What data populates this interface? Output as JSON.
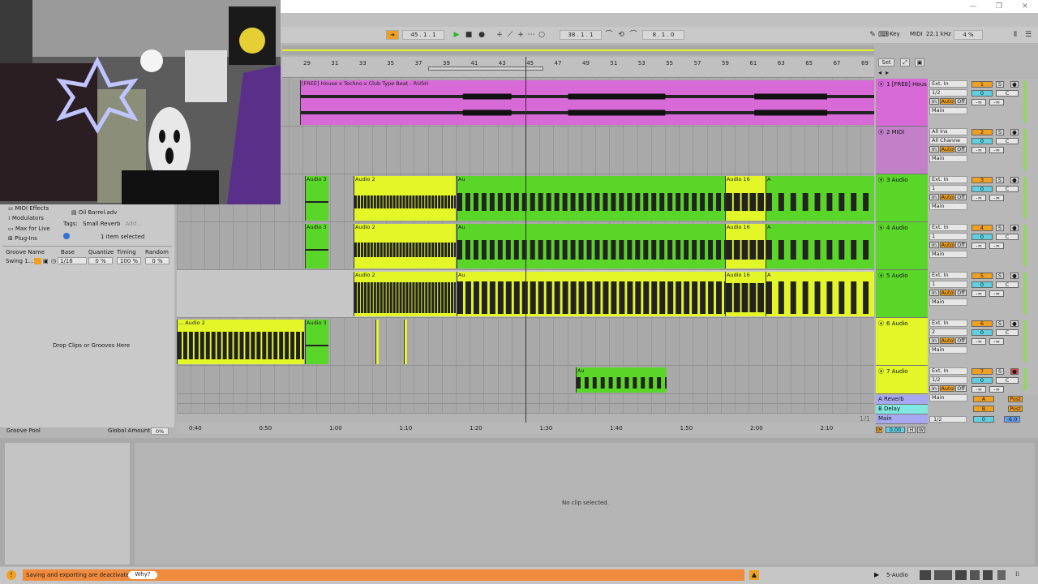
{
  "window": {
    "minimize": "—",
    "restore": "❐",
    "close": "✕"
  },
  "transport": {
    "position": "45 . 1 . 1",
    "loop_start": "38 . 1 . 1",
    "loop_length": "8 . 1 . 0",
    "key_label": "Key",
    "midi_label": "MIDI",
    "sample_rate": "22.1 kHz",
    "cpu": "4 %"
  },
  "ruler": {
    "bars": [
      "29",
      "31",
      "33",
      "35",
      "37",
      "39",
      "41",
      "43",
      "45",
      "47",
      "49",
      "51",
      "53",
      "55",
      "57",
      "59",
      "61",
      "63",
      "65",
      "67",
      "69"
    ],
    "set_label": "Set"
  },
  "timeline": {
    "times": [
      "0:40",
      "0:50",
      "1:00",
      "1:10",
      "1:20",
      "1:30",
      "1:40",
      "1:50",
      "2:00",
      "2:10"
    ],
    "page": "1/1"
  },
  "clips": {
    "track1": "[FREE] House x Techno x Club Type Beat - RUSH",
    "audio3": "Audio 3",
    "audio2": "Audio 2",
    "audio16": "Audio 16",
    "a": "A",
    "au": "Au",
    "ellipsis_audio2": "... Audio 2"
  },
  "tracks": [
    {
      "name": "1 [FREE] Hous",
      "input": "Ext. In",
      "channel": "1/2",
      "output": "Main",
      "number": "1",
      "color": "#d86ad8"
    },
    {
      "name": "2 MIDI",
      "input": "All Ins",
      "channel": "All Channe",
      "output": "Main",
      "number": "2",
      "color": "#c280c8"
    },
    {
      "name": "3 Audio",
      "input": "Ext. In",
      "channel": "1",
      "output": "Main",
      "number": "3",
      "color": "#5ad628"
    },
    {
      "name": "4 Audio",
      "input": "Ext. In",
      "channel": "1",
      "output": "Main",
      "number": "4",
      "color": "#5ad628"
    },
    {
      "name": "5 Audio",
      "input": "Ext. In",
      "channel": "1",
      "output": "Main",
      "number": "5",
      "color": "#5ad628"
    },
    {
      "name": "6 Audio",
      "input": "Ext. In",
      "channel": "2",
      "output": "Main",
      "number": "6",
      "color": "#e2f628"
    },
    {
      "name": "7 Audio",
      "input": "Ext. In",
      "channel": "1/2",
      "output": "Main",
      "number": "7",
      "color": "#e2f628"
    }
  ],
  "monitor": {
    "in": "In",
    "auto": "Auto",
    "off": "Off"
  },
  "mixer": {
    "vol": "0",
    "pan": "C",
    "send": "-∞",
    "solo": "S"
  },
  "returns": [
    {
      "name": "A Reverb",
      "letter": "A",
      "post": "Post",
      "color": "#a8a8f0"
    },
    {
      "name": "B Delay",
      "letter": "B",
      "post": "Post",
      "color": "#80e8e0"
    }
  ],
  "main": {
    "name": "Main",
    "channel": "1/2",
    "vol": "0",
    "meter": "-6.0"
  },
  "footer_buttons": {
    "zoom": "0.00",
    "h": "H",
    "w": "W"
  },
  "browser": {
    "categories": [
      "MIDI Effects",
      "Modulators",
      "Max for Live",
      "Plug-Ins"
    ],
    "file": "Oil Barrel.adv",
    "tags_label": "Tags:",
    "tag": "Small Reverb",
    "tag_add": "Add...",
    "selected_info": "1 item selected"
  },
  "groove": {
    "headers": [
      "Groove Name",
      "Base",
      "Quantize",
      "Timing",
      "Random"
    ],
    "row": {
      "name": "Swing 1...",
      "base": "1/16",
      "quantize": "0 %",
      "timing": "100 %",
      "random": "0 %"
    },
    "drop_text": "Drop Clips or Grooves Here",
    "pool_label": "Groove Pool",
    "global_amount_label": "Global Amount",
    "global_amount": "0%"
  },
  "detail": {
    "no_clip": "No clip selected."
  },
  "status": {
    "message": "Saving and exporting are deactivated.",
    "why": "Why?",
    "track_label": "5-Audio"
  },
  "colors": {
    "track_pink": "#d86ad8",
    "track_green": "#5ad628",
    "track_yellow": "#e2f628",
    "accent_orange": "#f0a020",
    "status_orange": "#f08a3c",
    "solo_blue": "#60d0e0"
  }
}
